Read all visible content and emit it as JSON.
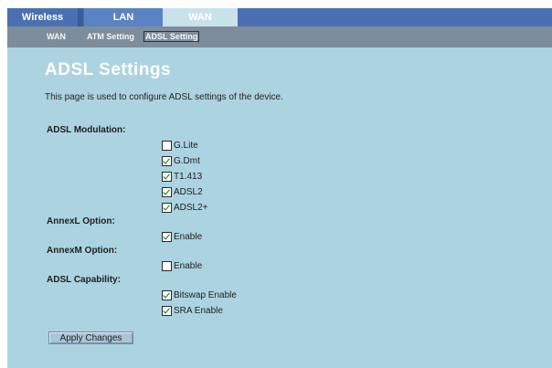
{
  "tabs": [
    {
      "label": "Wireless",
      "active": false
    },
    {
      "label": "LAN",
      "active": false
    },
    {
      "label": "WAN",
      "active": true
    }
  ],
  "subnav": [
    {
      "label": "WAN",
      "active": false
    },
    {
      "label": "ATM Setting",
      "active": false
    },
    {
      "label": "ADSL Setting",
      "active": true
    }
  ],
  "page": {
    "title": "ADSL Settings",
    "description": "This page is used to configure ADSL settings of the device."
  },
  "sections": {
    "modulation": {
      "label": "ADSL Modulation:",
      "options": [
        {
          "label": "G.Lite",
          "checked": false
        },
        {
          "label": "G.Dmt",
          "checked": true
        },
        {
          "label": "T1.413",
          "checked": true
        },
        {
          "label": "ADSL2",
          "checked": true
        },
        {
          "label": "ADSL2+",
          "checked": true
        }
      ]
    },
    "annexl": {
      "label": "AnnexL Option:",
      "options": [
        {
          "label": "Enable",
          "checked": true
        }
      ]
    },
    "annexm": {
      "label": "AnnexM Option:",
      "options": [
        {
          "label": "Enable",
          "checked": false
        }
      ]
    },
    "capability": {
      "label": "ADSL Capability:",
      "options": [
        {
          "label": "Bitswap Enable",
          "checked": true
        },
        {
          "label": "SRA Enable",
          "checked": true
        }
      ]
    }
  },
  "apply_label": "Apply Changes",
  "colors": {
    "tab_bar": "#4a70b3",
    "active_tab": "#c9e2ea",
    "subnav": "#7e8d9b",
    "panel": "#acd3e0"
  }
}
